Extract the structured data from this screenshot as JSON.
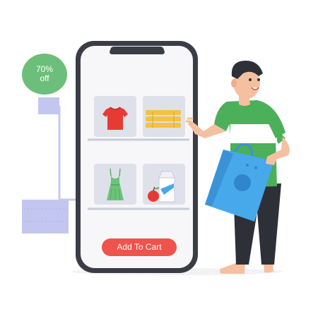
{
  "badge": {
    "line1": "70%",
    "line2": "off"
  },
  "phone": {
    "screen_color": "#f7f7f9",
    "products": [
      {
        "name": "t-shirt-icon"
      },
      {
        "name": "folded-clothes-icon"
      },
      {
        "name": "dress-icon"
      },
      {
        "name": "apple-and-milk-icon"
      }
    ],
    "cart_button_label": "Add To Cart"
  },
  "colors": {
    "accent": "#f0524c",
    "badge_green": "#6cbf7a",
    "phone_frame": "#3a3d46",
    "bag_blue": "#47a9ea",
    "shirt_green": "#4caf5a"
  }
}
